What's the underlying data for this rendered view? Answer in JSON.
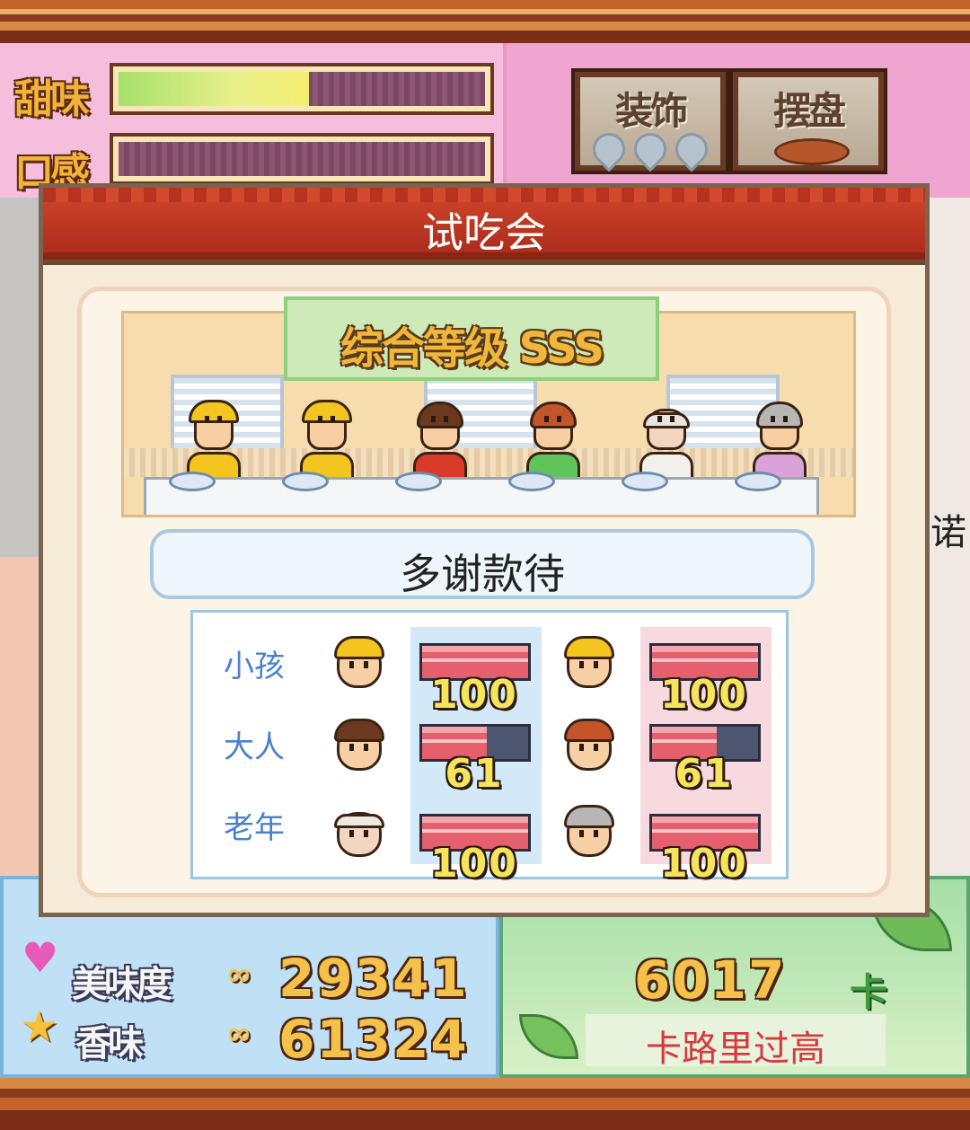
{
  "hud": {
    "sweetness_label": "甜味",
    "sweetness_level": 0.52,
    "texture_label": "口感",
    "texture_level": 0.0,
    "decor_button": "装饰",
    "plating_button": "摆盘",
    "side_partial_text": "诺"
  },
  "dialog": {
    "title": "试吃会",
    "overall_rating": "综合等级 SSS",
    "speech": "多谢款待",
    "rows": [
      {
        "label": "小孩",
        "left_score": "100",
        "left_value": 100,
        "right_score": "100",
        "right_value": 100
      },
      {
        "label": "大人",
        "left_score": "61",
        "left_value": 61,
        "right_score": "61",
        "right_value": 61
      },
      {
        "label": "老年",
        "left_score": "100",
        "left_value": 100,
        "right_score": "100",
        "right_value": 100
      }
    ]
  },
  "stats": {
    "flavor_label": "美味度",
    "flavor_value": "29341",
    "aroma_label": "香味",
    "aroma_value": "61324",
    "infinity": "∞",
    "calorie_value": "6017",
    "calorie_unit": "卡",
    "calorie_warning": "卡路里过高"
  },
  "colors": {
    "title_bar": "#c23a22",
    "rating_gold": "#f0b73c",
    "label_blue": "#4b80cf",
    "meter_red": "#e5606c",
    "warning_red": "#d8383c"
  }
}
